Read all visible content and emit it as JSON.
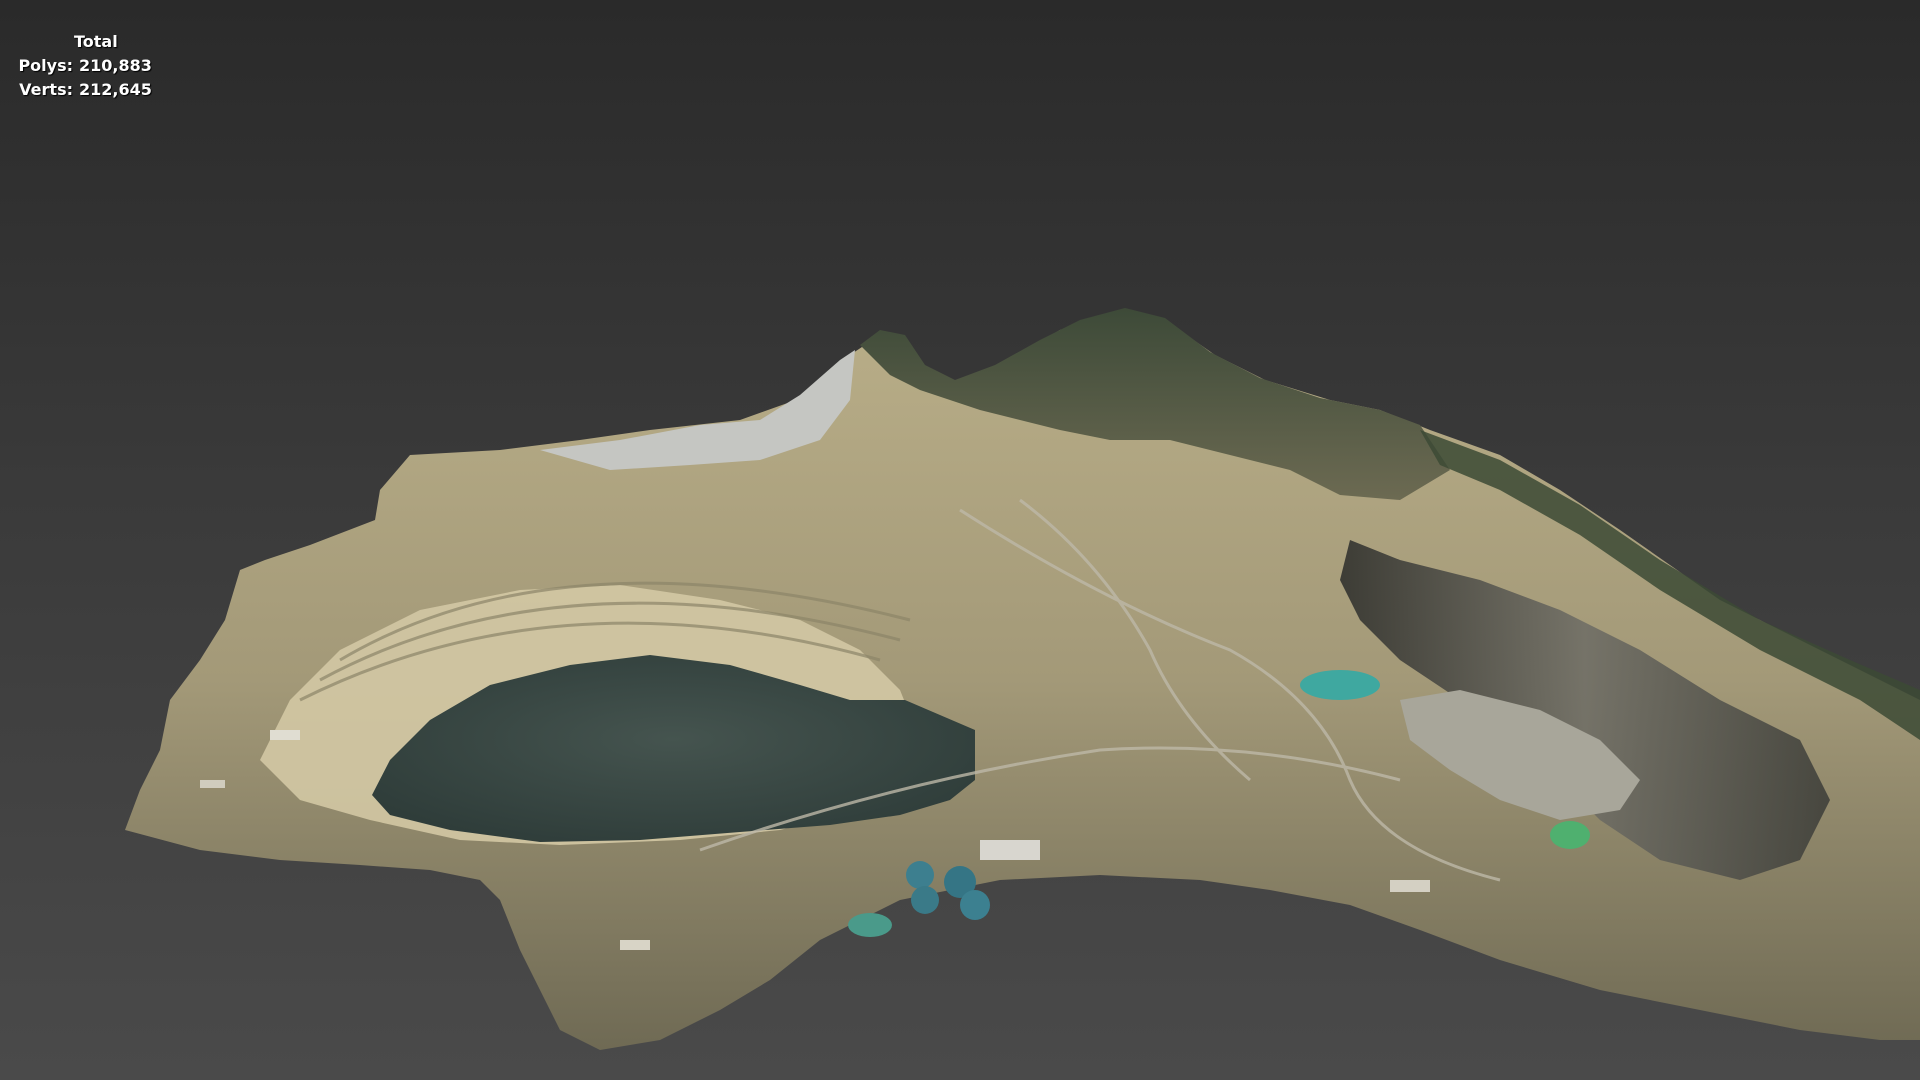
{
  "stats": {
    "title": "Total",
    "polys_label": "Polys:",
    "polys_value": "210,883",
    "verts_label": "Verts:",
    "verts_value": "212,645"
  },
  "viewport": {
    "background_top": "#2a2a2a",
    "background_bottom": "#4a4a4a"
  },
  "model": {
    "subject": "open-pit-mine-terrain",
    "colors": {
      "rock_light": "#c8bd98",
      "rock_mid": "#9c9170",
      "rock_dark": "#5f5a48",
      "vegetation": "#3c4a35",
      "pit_water": "#3a4a47",
      "teal_pond": "#3fa8a0",
      "green_pond": "#4fb06f",
      "shadow_terraces": "#2f302e"
    }
  }
}
